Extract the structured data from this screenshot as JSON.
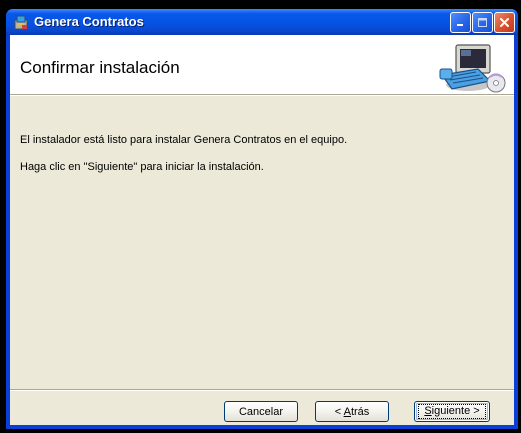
{
  "window": {
    "title": "Genera Contratos",
    "titlebar_color": "#0a58ea"
  },
  "header": {
    "title": "Confirmar instalación",
    "graphic": "computer-with-cd-icon"
  },
  "body": {
    "line1": "El instalador está listo para instalar Genera Contratos en el equipo.",
    "line2": "Haga clic en \"Siguiente\" para iniciar la instalación."
  },
  "buttons": {
    "cancel": "Cancelar",
    "back_prefix": "< ",
    "back_accel": "A",
    "back_rest": "trás",
    "next_accel": "S",
    "next_rest": "iguiente >"
  },
  "titlebar_buttons": [
    "minimize-icon",
    "maximize-icon",
    "close-icon"
  ]
}
